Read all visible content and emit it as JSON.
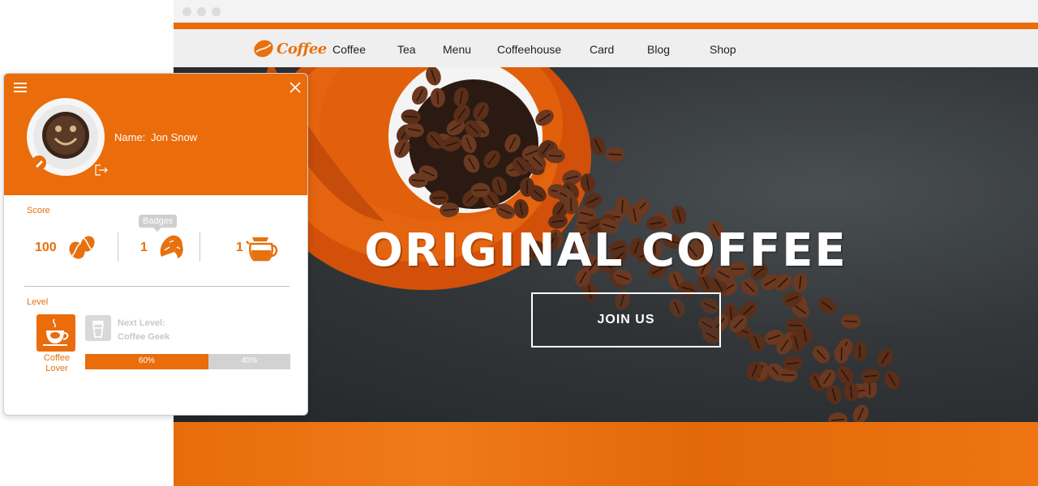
{
  "browser": {
    "brand": {
      "logo_text": "Coffee",
      "accent_color": "#ea6c0a"
    },
    "nav": [
      "Coffee",
      "Tea",
      "Menu",
      "Coffeehouse",
      "Card",
      "Blog",
      "Shop"
    ],
    "hero": {
      "title": "ORIGINAL COFFEE",
      "cta_label": "JOIN US"
    }
  },
  "profile": {
    "name_label": "Name:",
    "name_value": "Jon Snow",
    "score_label": "Score",
    "scores": [
      {
        "value": "100",
        "icon": "coffee-beans-icon"
      },
      {
        "value": "1",
        "icon": "croissant-icon"
      },
      {
        "value": "1",
        "icon": "coffee-pot-icon"
      }
    ],
    "tooltip": "Badges",
    "level_label": "Level",
    "current_level": "Coffee Lover",
    "next_level_prefix": "Next Level:",
    "next_level_name": "Coffee Geek",
    "progress": {
      "done": 0.6,
      "done_label": "60%",
      "remaining_label": "40%"
    }
  }
}
